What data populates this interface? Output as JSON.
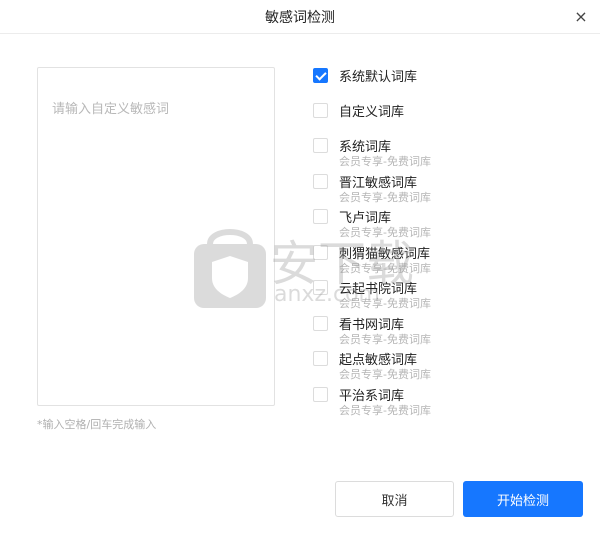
{
  "dialog": {
    "title": "敏感词检测",
    "close_glyph": "×"
  },
  "input": {
    "placeholder": "请输入自定义敏感词",
    "hint": "*输入空格/回车完成输入"
  },
  "libraries": [
    {
      "name": "系统默认词库",
      "sub": "",
      "checked": true
    },
    {
      "name": "自定义词库",
      "sub": "",
      "checked": false
    },
    {
      "name": "系统词库",
      "sub": "会员专享-免费词库",
      "checked": false
    },
    {
      "name": "晋江敏感词库",
      "sub": "会员专享-免费词库",
      "checked": false
    },
    {
      "name": "飞卢词库",
      "sub": "会员专享-免费词库",
      "checked": false
    },
    {
      "name": "刺猬猫敏感词库",
      "sub": "会员专享-免费词库",
      "checked": false
    },
    {
      "name": "云起书院词库",
      "sub": "会员专享-免费词库",
      "checked": false
    },
    {
      "name": "看书网词库",
      "sub": "会员专享-免费词库",
      "checked": false
    },
    {
      "name": "起点敏感词库",
      "sub": "会员专享-免费词库",
      "checked": false
    },
    {
      "name": "平治系词库",
      "sub": "会员专享-免费词库",
      "checked": false
    }
  ],
  "buttons": {
    "cancel": "取消",
    "start": "开始检测"
  },
  "watermark": {
    "logo_text": "安下载",
    "domain_text": "anxz.com"
  },
  "colors": {
    "accent": "#1677ff",
    "muted": "#b6b6b6"
  }
}
